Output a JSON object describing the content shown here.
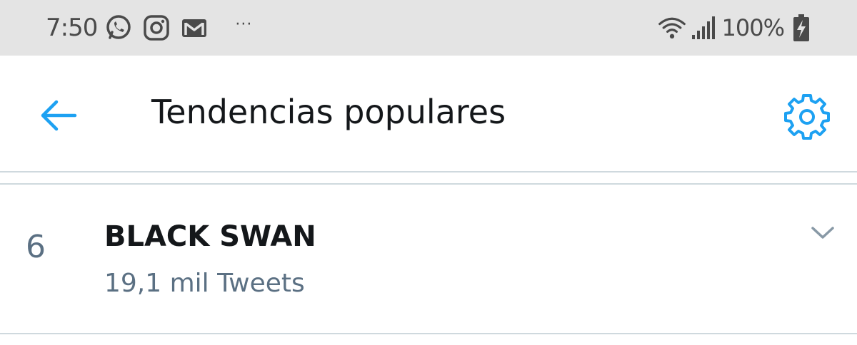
{
  "status_bar": {
    "time": "7:50",
    "notification_icons": [
      "whatsapp-icon",
      "instagram-icon",
      "gmail-icon"
    ],
    "more_indicator": "···",
    "battery_percent": "100%",
    "status_icons": [
      "wifi-icon",
      "signal-icon",
      "battery-charging-icon"
    ]
  },
  "header": {
    "title": "Tendencias populares",
    "back_icon": "back-arrow-icon",
    "settings_icon": "gear-icon"
  },
  "trends": [
    {
      "rank": "6",
      "name": "BLACK SWAN",
      "tweet_count": "19,1 mil Tweets",
      "menu_icon": "chevron-down-icon"
    }
  ],
  "colors": {
    "accent": "#1da1f2",
    "status_bar_bg": "#e4e4e4",
    "text_primary": "#14171a",
    "text_secondary": "#5b7083",
    "divider": "#cfd9de"
  }
}
